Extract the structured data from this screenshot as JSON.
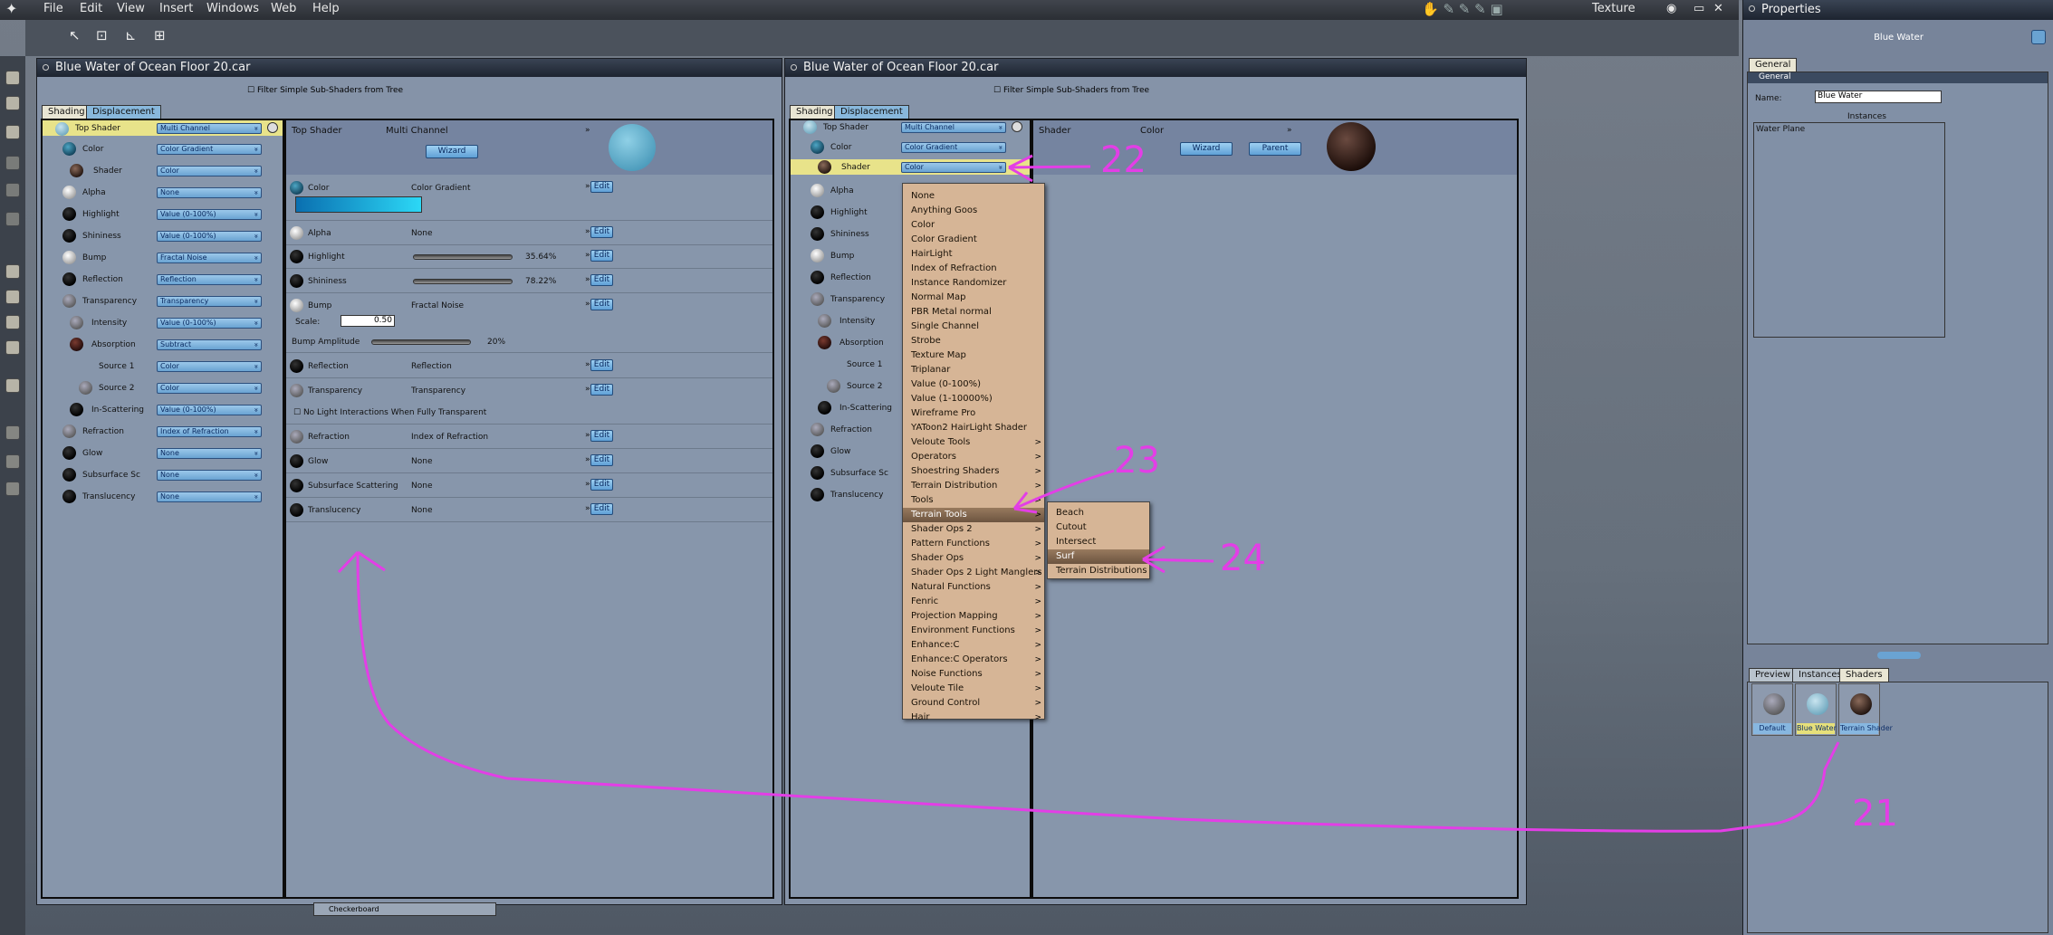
{
  "menubar": {
    "items": [
      "File",
      "Edit",
      "View",
      "Insert",
      "Windows",
      "Web",
      "Help"
    ],
    "room": "Texture"
  },
  "properties": {
    "title": "Properties",
    "object_name": "Blue Water",
    "tab_general": "General",
    "section_general": "General",
    "name_label": "Name:",
    "name_value": "Blue Water",
    "instances_label": "Instances",
    "instances": [
      "Water Plane"
    ],
    "bottom_tabs": [
      "Preview",
      "Instances",
      "Shaders"
    ],
    "shaders": [
      "Default",
      "Blue Water",
      "Terrain Shader"
    ]
  },
  "left_window": {
    "title": "Blue Water of Ocean Floor 20.car",
    "filter_label": "Filter Simple Sub-Shaders from Tree",
    "tabs": [
      "Shading",
      "Displacement"
    ],
    "tree": [
      {
        "label": "Top Shader",
        "value": "Multi Channel"
      },
      {
        "label": "Color",
        "value": "Color Gradient"
      },
      {
        "label": "Shader",
        "value": "Color"
      },
      {
        "label": "Alpha",
        "value": "None"
      },
      {
        "label": "Highlight",
        "value": "Value (0-100%)"
      },
      {
        "label": "Shininess",
        "value": "Value (0-100%)"
      },
      {
        "label": "Bump",
        "value": "Fractal Noise"
      },
      {
        "label": "Reflection",
        "value": "Reflection"
      },
      {
        "label": "Transparency",
        "value": "Transparency"
      },
      {
        "label": "Intensity",
        "value": "Value (0-100%)"
      },
      {
        "label": "Absorption",
        "value": "Subtract"
      },
      {
        "label": "Source 1",
        "value": "Color"
      },
      {
        "label": "Source 2",
        "value": "Color"
      },
      {
        "label": "In-Scattering",
        "value": "Value (0-100%)"
      },
      {
        "label": "Refraction",
        "value": "Index of Refraction"
      },
      {
        "label": "Glow",
        "value": "None"
      },
      {
        "label": "Subsurface Sc",
        "value": "None"
      },
      {
        "label": "Translucency",
        "value": "None"
      }
    ],
    "editor": {
      "header_label": "Top Shader",
      "header_value": "Multi Channel",
      "wizard": "Wizard",
      "edit": "Edit",
      "color_label": "Color",
      "color_value": "Color Gradient",
      "alpha_label": "Alpha",
      "alpha_value": "None",
      "highlight_label": "Highlight",
      "highlight_pct": "35.64%",
      "shininess_label": "Shininess",
      "shininess_pct": "78.22%",
      "bump_label": "Bump",
      "bump_value": "Fractal Noise",
      "scale_label": "Scale:",
      "scale_value": "0.50",
      "bump_amp_label": "Bump Amplitude",
      "bump_amp_pct": "20%",
      "reflection_label": "Reflection",
      "reflection_value": "Reflection",
      "transparency_label": "Transparency",
      "transparency_value": "Transparency",
      "nolight_label": "No Light Interactions When Fully Transparent",
      "refraction_label": "Refraction",
      "refraction_value": "Index of Refraction",
      "glow_label": "Glow",
      "glow_value": "None",
      "sss_label": "Subsurface Scattering",
      "sss_value": "None",
      "translucency_label": "Translucency",
      "translucency_value": "None"
    },
    "bottom_item": "Checkerboard"
  },
  "right_window": {
    "title": "Blue Water of Ocean Floor 20.car",
    "filter_label": "Filter Simple Sub-Shaders from Tree",
    "tabs": [
      "Shading",
      "Displacement"
    ],
    "tree": [
      {
        "label": "Top Shader",
        "value": "Multi Channel"
      },
      {
        "label": "Color",
        "value": "Color Gradient"
      },
      {
        "label": "Shader",
        "value": "Color"
      },
      {
        "label": "Alpha"
      },
      {
        "label": "Highlight"
      },
      {
        "label": "Shininess"
      },
      {
        "label": "Bump"
      },
      {
        "label": "Reflection"
      },
      {
        "label": "Transparency"
      },
      {
        "label": "Intensity"
      },
      {
        "label": "Absorption"
      },
      {
        "label": "Source 1"
      },
      {
        "label": "Source 2"
      },
      {
        "label": "In-Scattering"
      },
      {
        "label": "Refraction"
      },
      {
        "label": "Glow"
      },
      {
        "label": "Subsurface Sc"
      },
      {
        "label": "Translucency"
      }
    ],
    "editor": {
      "header_label": "Shader",
      "header_value": "Color",
      "wizard": "Wizard",
      "parent": "Parent"
    }
  },
  "dropdown_menu": [
    "None",
    "Anything Goos",
    "Color",
    "Color Gradient",
    "HairLight",
    "Index of Refraction",
    "Instance Randomizer",
    "Normal Map",
    "PBR Metal normal",
    "Single Channel",
    "Strobe",
    "Texture Map",
    "Triplanar",
    "Value (0-100%)",
    "Value (1-10000%)",
    "Wireframe Pro",
    "YAToon2 HairLight Shader",
    "Veloute Tools",
    "Operators",
    "Shoestring Shaders",
    "Terrain Distribution",
    "Tools",
    "Terrain Tools",
    "Shader Ops 2",
    "Pattern Functions",
    "Shader Ops",
    "Shader Ops 2 Light Manglers",
    "Natural Functions",
    "Fenric",
    "Projection Mapping",
    "Environment Functions",
    "Enhance:C",
    "Enhance:C Operators",
    "Noise Functions",
    "Veloute Tile",
    "Ground Control",
    "Hair"
  ],
  "submenu_arrows_from": "Veloute Tools",
  "selected_item": "Terrain Tools",
  "submenu": [
    "Beach",
    "Cutout",
    "Intersect",
    "Surf",
    "Terrain Distributions"
  ],
  "submenu_selected": "Surf",
  "annotations": [
    "22",
    "23",
    "24",
    "21"
  ],
  "annotation_color": "#e33ee6"
}
